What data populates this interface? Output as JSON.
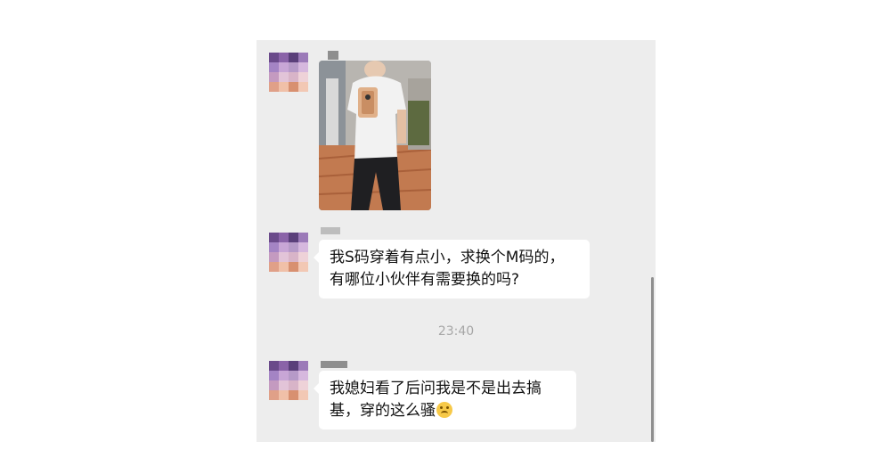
{
  "messages": [
    {
      "type": "image",
      "description_none": ""
    },
    {
      "type": "text",
      "text": "我S码穿着有点小，求换个M码的，有哪位小伙伴有需要换的吗?"
    },
    {
      "type": "text",
      "text": "我媳妇看了后问我是不是出去搞基，穿的这么骚"
    }
  ],
  "timestamp": "23:40",
  "colors": {
    "chat_bg": "#ededed",
    "bubble_bg": "#ffffff",
    "time_text": "#a6a6a6"
  },
  "icons": [
    "pixelated-avatar",
    "crying-laughing-emoji"
  ]
}
